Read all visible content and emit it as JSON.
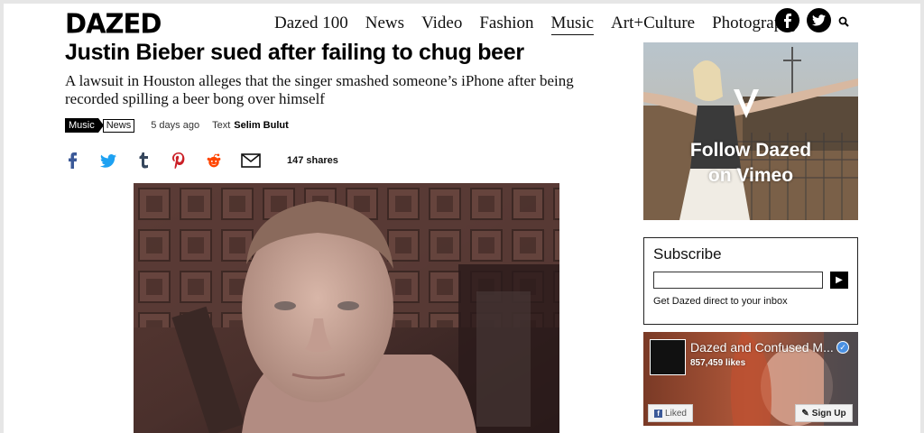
{
  "header": {
    "logo": "DAZED",
    "nav": [
      "Dazed 100",
      "News",
      "Video",
      "Fashion",
      "Music",
      "Art+Culture",
      "Photography"
    ],
    "active_nav": "Music"
  },
  "article": {
    "headline": "Justin Bieber sued after failing to chug beer",
    "subhead": "A lawsuit in Houston alleges that the singer smashed someone’s iPhone after being recorded spilling a beer bong over himself",
    "tags": {
      "primary": "Music",
      "secondary": "News"
    },
    "date": "5 days ago",
    "text_label": "Text",
    "author": "Selim Bulut",
    "shares": "147 shares"
  },
  "sidebar": {
    "vimeo": {
      "line1": "Follow Dazed",
      "line2": "on Vimeo"
    },
    "subscribe": {
      "title": "Subscribe",
      "button_label": "▶",
      "note": "Get Dazed direct to your inbox"
    },
    "facebook": {
      "page_name": "Dazed and Confused M...",
      "likes": "857,459 likes",
      "liked_label": "Liked",
      "signup_label": "Sign Up"
    }
  },
  "colors": {
    "facebook": "#3b5998",
    "twitter": "#1da1f2",
    "tumblr": "#35465c",
    "pinterest": "#cb2027",
    "reddit": "#ff4500"
  }
}
